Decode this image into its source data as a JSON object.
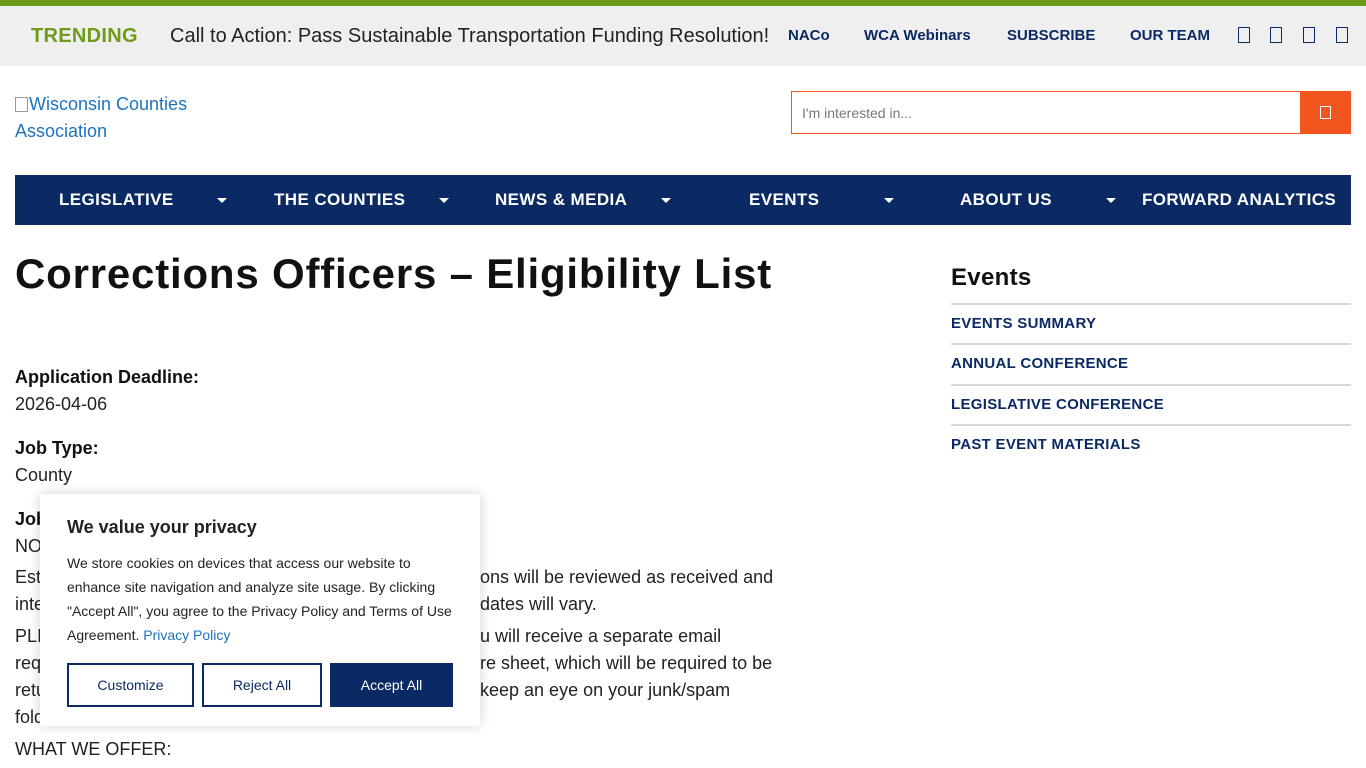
{
  "colors": {
    "accent_green": "#6f9b1c",
    "navy": "#0b2a63",
    "orange": "#f2551d",
    "link_blue": "#1e73be"
  },
  "topbar": {
    "trending_label": "TRENDING",
    "trending_text": "Call to Action: Pass Sustainable Transportation Funding Resolution!",
    "links": [
      "NACo",
      "WCA Webinars",
      "SUBSCRIBE",
      "OUR TEAM"
    ],
    "social_icons": [
      "social-icon-1",
      "social-icon-2",
      "social-icon-3",
      "social-icon-4"
    ]
  },
  "logo": {
    "alt_text": "Wisconsin Counties Association"
  },
  "search": {
    "placeholder": "I'm interested in...",
    "icon": "search-icon"
  },
  "nav": {
    "items": [
      {
        "label": "LEGISLATIVE",
        "has_dropdown": true
      },
      {
        "label": "THE COUNTIES",
        "has_dropdown": true
      },
      {
        "label": "NEWS & MEDIA",
        "has_dropdown": true
      },
      {
        "label": "EVENTS",
        "has_dropdown": true
      },
      {
        "label": "ABOUT US",
        "has_dropdown": true
      },
      {
        "label": "FORWARD ANALYTICS",
        "has_dropdown": false
      }
    ]
  },
  "main": {
    "title": "Corrections Officers – Eligibility List",
    "deadline_label": "Application Deadline:",
    "deadline_value": "2026-04-06",
    "job_type_label": "Job Type:",
    "job_type_value": "County",
    "job_label_partial": "Job",
    "job_value_partial": "NO",
    "para1_a": "Est",
    "para1_b": "ons will be reviewed as received and",
    "para1_c": "inte",
    "para1_d": "dates will vary.",
    "para2_a": "PLI",
    "para2_b": "u will receive a separate email",
    "para2_c": "req",
    "para2_d": "re sheet, which will be required to be",
    "para2_e": "retu",
    "para2_f": "keep an eye on your junk/spam",
    "para2_g": "fold",
    "offer_heading": "WHAT WE OFFER:"
  },
  "sidebar": {
    "title": "Events",
    "links": [
      "EVENTS SUMMARY",
      "ANNUAL CONFERENCE",
      "LEGISLATIVE CONFERENCE",
      "PAST EVENT MATERIALS"
    ]
  },
  "cookie": {
    "title": "We value your privacy",
    "text": "We store cookies on devices that access our website to enhance site navigation and analyze site usage. By clicking \"Accept All\", you agree to the Privacy Policy and Terms of Use Agreement.",
    "policy_link": "Privacy Policy",
    "customize": "Customize",
    "reject": "Reject All",
    "accept": "Accept All"
  }
}
